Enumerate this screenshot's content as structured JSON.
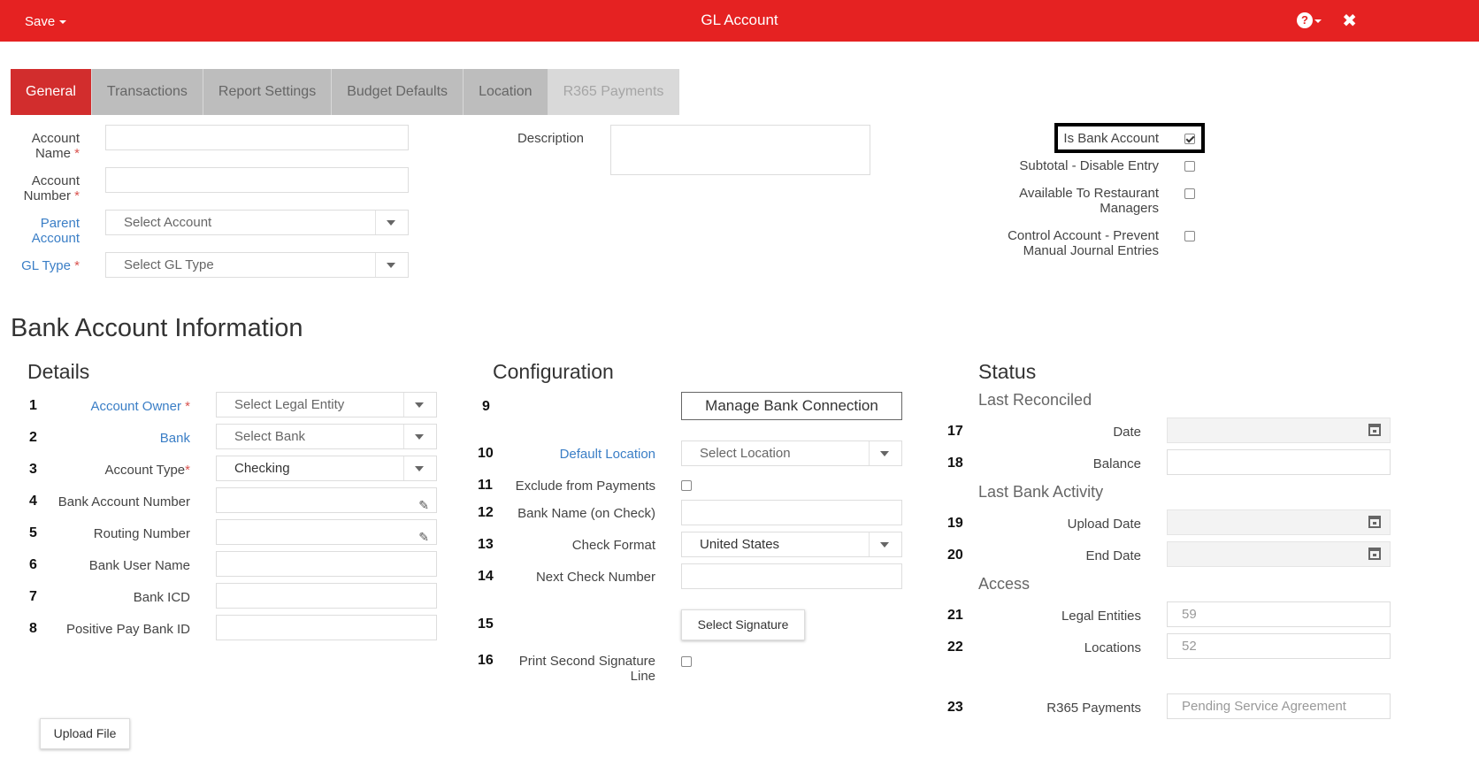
{
  "header": {
    "save_label": "Save",
    "title": "GL Account",
    "help_icon": "?",
    "close_icon": "✖"
  },
  "tabs": [
    {
      "label": "General",
      "active": true
    },
    {
      "label": "Transactions"
    },
    {
      "label": "Report Settings"
    },
    {
      "label": "Budget Defaults"
    },
    {
      "label": "Location"
    },
    {
      "label": "R365 Payments",
      "disabled": true
    }
  ],
  "general": {
    "account_name": "Account Name",
    "account_name_value": "",
    "account_number": "Account Number",
    "account_number_value": "",
    "parent_account": "Parent Account",
    "parent_account_placeholder": "Select Account",
    "gl_type": "GL Type",
    "gl_type_placeholder": "Select GL Type",
    "required_marker": "*",
    "description": "Description",
    "description_value": ""
  },
  "flags": [
    {
      "label": "Is Bank Account",
      "checked": true
    },
    {
      "label": "Subtotal - Disable Entry",
      "checked": false
    },
    {
      "label": "Available To Restaurant Managers",
      "checked": false
    },
    {
      "label": "Control Account - Prevent Manual Journal Entries",
      "checked": false
    }
  ],
  "bank_section": {
    "title": "Bank Account Information",
    "details": {
      "title": "Details",
      "rows": [
        {
          "num": "1",
          "label": "Account Owner",
          "value": "Select Legal Entity"
        },
        {
          "num": "2",
          "label": "Bank",
          "value": "Select Bank"
        },
        {
          "num": "3",
          "label": "Account Type",
          "value": "Checking"
        },
        {
          "num": "4",
          "label": "Bank Account Number",
          "value": ""
        },
        {
          "num": "5",
          "label": "Routing Number",
          "value": ""
        },
        {
          "num": "6",
          "label": "Bank User Name",
          "value": ""
        },
        {
          "num": "7",
          "label": "Bank ICD",
          "value": ""
        },
        {
          "num": "8",
          "label": "Positive Pay Bank ID",
          "value": ""
        }
      ]
    },
    "configuration": {
      "title": "Configuration",
      "rows": [
        {
          "num": "9",
          "label": "",
          "value": "Manage Bank Connection"
        },
        {
          "num": "10",
          "label": "Default Location",
          "value": "Select Location"
        },
        {
          "num": "11",
          "label": "Exclude from Payments",
          "checked": false
        },
        {
          "num": "12",
          "label": "Bank Name (on Check)",
          "value": ""
        },
        {
          "num": "13",
          "label": "Check Format",
          "value": "United States"
        },
        {
          "num": "14",
          "label": "Next Check Number",
          "value": ""
        },
        {
          "num": "15",
          "label": "",
          "value": "Select Signature"
        },
        {
          "num": "16",
          "label": "Print Second Signature Line",
          "checked": false
        }
      ]
    },
    "status": {
      "title": "Status",
      "last_reconciled": "Last Reconciled",
      "last_bank_activity": "Last Bank Activity",
      "access": "Access",
      "rows": [
        {
          "num": "17",
          "label": "Date",
          "value": ""
        },
        {
          "num": "18",
          "label": "Balance",
          "value": ""
        },
        {
          "num": "19",
          "label": "Upload Date",
          "value": ""
        },
        {
          "num": "20",
          "label": "End Date",
          "value": ""
        },
        {
          "num": "21",
          "label": "Legal Entities",
          "value": "59"
        },
        {
          "num": "22",
          "label": "Locations",
          "value": "52"
        },
        {
          "num": "23",
          "label": "R365 Payments",
          "value": "Pending Service Agreement"
        }
      ]
    }
  },
  "upload_button": "Upload File"
}
